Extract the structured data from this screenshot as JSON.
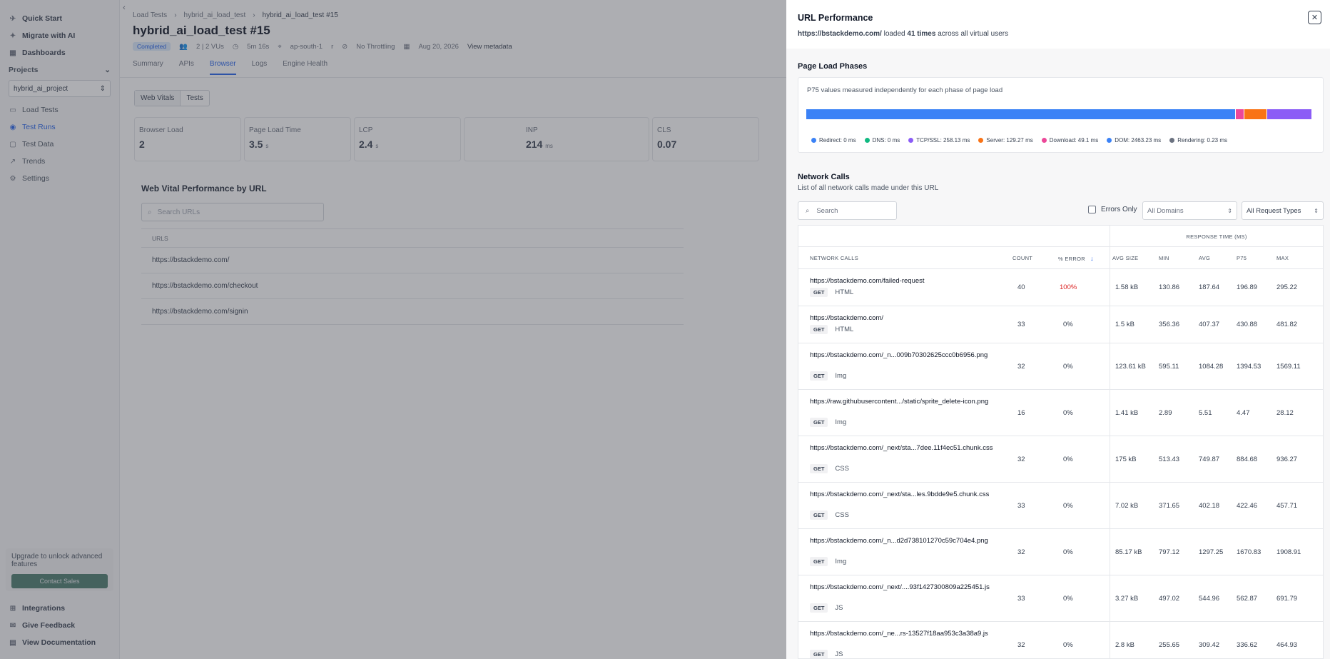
{
  "sidebar": {
    "top_items": [
      {
        "label": "Quick Start",
        "icon": "rocket-icon"
      },
      {
        "label": "Migrate with AI",
        "icon": "sparkle-icon"
      },
      {
        "label": "Dashboards",
        "icon": "grid-icon"
      }
    ],
    "projects_label": "Projects",
    "project_selected": "hybrid_ai_project",
    "project_items": [
      {
        "label": "Load Tests",
        "icon": "folder-icon"
      },
      {
        "label": "Test Runs",
        "icon": "play-icon"
      },
      {
        "label": "Test Data",
        "icon": "file-icon"
      },
      {
        "label": "Trends",
        "icon": "trend-icon"
      },
      {
        "label": "Settings",
        "icon": "gear-icon"
      }
    ],
    "upgrade_text": "Upgrade to unlock advanced features",
    "upgrade_button": "Contact Sales",
    "bottom_items": [
      {
        "label": "Integrations"
      },
      {
        "label": "Give Feedback"
      },
      {
        "label": "View Documentation"
      }
    ]
  },
  "main": {
    "breadcrumbs": [
      "Load Tests",
      "hybrid_ai_load_test",
      "hybrid_ai_load_test #15"
    ],
    "title": "hybrid_ai_load_test #15",
    "meta": {
      "status": "Completed",
      "vus": "2 | 2 VUs",
      "duration": "5m 16s",
      "region": "ap-south-1",
      "runner": "r",
      "throttling": "No Throttling",
      "date": "Aug 20, 2026",
      "view_metadata": "View metadata"
    },
    "tabs": [
      "Summary",
      "APIs",
      "Browser",
      "Logs",
      "Engine Health"
    ],
    "active_tab": "Browser",
    "segments": [
      "Web Vitals",
      "Tests"
    ],
    "metrics": [
      {
        "label": "Browser Load",
        "value": "2",
        "unit": ""
      },
      {
        "label": "Page Load Time",
        "value": "3.5",
        "unit": "s"
      },
      {
        "label": "LCP",
        "value": "2.4",
        "unit": "s"
      },
      {
        "label": "INP",
        "value": "214",
        "unit": "ms"
      },
      {
        "label": "CLS",
        "value": "0.07",
        "unit": ""
      }
    ],
    "wv_title": "Web Vital Performance by URL",
    "url_search_placeholder": "Search URLs",
    "url_header": "URLS",
    "urls": [
      "https://bstackdemo.com/",
      "https://bstackdemo.com/checkout",
      "https://bstackdemo.com/signin"
    ]
  },
  "drawer": {
    "title": "URL Performance",
    "sub_url": "https://bstackdemo.com/",
    "sub_loaded": " loaded ",
    "sub_times": "41 times",
    "sub_rest": " across all virtual users",
    "phases": {
      "title": "Page Load Phases",
      "desc": "P75 values measured independently for each phase of page load",
      "bar": [
        {
          "name": "Redirect",
          "value": 0,
          "color": "#3b82f6"
        },
        {
          "name": "DNS",
          "value": 0,
          "color": "#10b981"
        },
        {
          "name": "TCP/SSL",
          "value": 258.13,
          "color": "#8b5cf6"
        },
        {
          "name": "Server",
          "value": 129.27,
          "color": "#f97316"
        },
        {
          "name": "Download",
          "value": 49.1,
          "color": "#ec4899"
        },
        {
          "name": "DOM",
          "value": 2463.23,
          "color": "#3b82f6"
        },
        {
          "name": "Rendering",
          "value": 0.23,
          "color": "#6b7280"
        }
      ],
      "legend": [
        {
          "text": "Redirect: 0 ms",
          "color": "#3b82f6"
        },
        {
          "text": "DNS: 0 ms",
          "color": "#10b981"
        },
        {
          "text": "TCP/SSL: 258.13 ms",
          "color": "#8b5cf6"
        },
        {
          "text": "Server: 129.27 ms",
          "color": "#f97316"
        },
        {
          "text": "Download: 49.1 ms",
          "color": "#ec4899"
        },
        {
          "text": "DOM: 2463.23 ms",
          "color": "#3b82f6"
        },
        {
          "text": "Rendering: 0.23 ms",
          "color": "#6b7280"
        }
      ]
    },
    "network": {
      "title": "Network Calls",
      "desc": "List of all network calls made under this URL",
      "search_placeholder": "Search",
      "errors_only": "Errors Only",
      "domains": "All Domains",
      "request_types": "All Request Types",
      "group_header": "RESPONSE TIME (MS)",
      "headers": {
        "calls": "NETWORK CALLS",
        "count": "COUNT",
        "error": "% ERROR",
        "size": "AVG SIZE",
        "min": "MIN",
        "avg": "AVG",
        "p75": "P75",
        "max": "MAX"
      },
      "rows": [
        {
          "url": "https://bstackdemo.com/failed-request",
          "method": "GET",
          "type": "HTML",
          "count": "40",
          "error": "100%",
          "size": "1.58 kB",
          "min": "130.86",
          "avg": "187.64",
          "p75": "196.89",
          "max": "295.22"
        },
        {
          "url": "https://bstackdemo.com/",
          "method": "GET",
          "type": "HTML",
          "count": "33",
          "error": "0%",
          "size": "1.5 kB",
          "min": "356.36",
          "avg": "407.37",
          "p75": "430.88",
          "max": "481.82"
        },
        {
          "url": "https://bstackdemo.com/_n...009b70302625ccc0b6956.png",
          "method": "GET",
          "type": "Img",
          "count": "32",
          "error": "0%",
          "size": "123.61 kB",
          "min": "595.11",
          "avg": "1084.28",
          "p75": "1394.53",
          "max": "1569.11"
        },
        {
          "url": "https://raw.githubusercontent.../static/sprite_delete-icon.png",
          "method": "GET",
          "type": "Img",
          "count": "16",
          "error": "0%",
          "size": "1.41 kB",
          "min": "2.89",
          "avg": "5.51",
          "p75": "4.47",
          "max": "28.12"
        },
        {
          "url": "https://bstackdemo.com/_next/sta...7dee.11f4ec51.chunk.css",
          "method": "GET",
          "type": "CSS",
          "count": "32",
          "error": "0%",
          "size": "175 kB",
          "min": "513.43",
          "avg": "749.87",
          "p75": "884.68",
          "max": "936.27"
        },
        {
          "url": "https://bstackdemo.com/_next/sta...les.9bdde9e5.chunk.css",
          "method": "GET",
          "type": "CSS",
          "count": "33",
          "error": "0%",
          "size": "7.02 kB",
          "min": "371.65",
          "avg": "402.18",
          "p75": "422.46",
          "max": "457.71"
        },
        {
          "url": "https://bstackdemo.com/_n...d2d738101270c59c704e4.png",
          "method": "GET",
          "type": "Img",
          "count": "32",
          "error": "0%",
          "size": "85.17 kB",
          "min": "797.12",
          "avg": "1297.25",
          "p75": "1670.83",
          "max": "1908.91"
        },
        {
          "url": "https://bstackdemo.com/_next/....93f1427300809a225451.js",
          "method": "GET",
          "type": "JS",
          "count": "33",
          "error": "0%",
          "size": "3.27 kB",
          "min": "497.02",
          "avg": "544.96",
          "p75": "562.87",
          "max": "691.79"
        },
        {
          "url": "https://bstackdemo.com/_ne...rs-13527f18aa953c3a38a9.js",
          "method": "GET",
          "type": "JS",
          "count": "32",
          "error": "0%",
          "size": "2.8 kB",
          "min": "255.65",
          "avg": "309.42",
          "p75": "336.62",
          "max": "464.93"
        }
      ]
    }
  }
}
